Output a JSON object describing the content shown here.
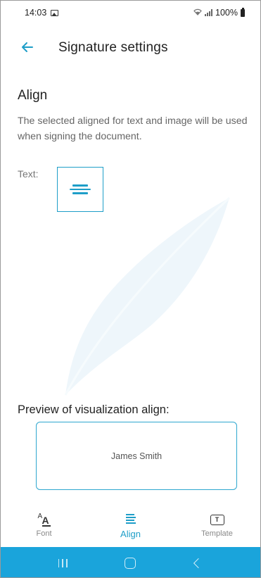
{
  "status_bar": {
    "time": "14:03",
    "battery": "100%",
    "icons": [
      "gallery-icon",
      "wifi-icon",
      "signal-icon",
      "battery-icon"
    ]
  },
  "app_bar": {
    "back_icon": "arrow-left-icon",
    "title": "Signature settings"
  },
  "align_section": {
    "title": "Align",
    "description": "The selected aligned for text and image will be used when signing the document.",
    "text_label": "Text:",
    "selected_alignment_icon": "align-center-icon"
  },
  "preview": {
    "label": "Preview of visualization align:",
    "name": "James Smith"
  },
  "bottom_nav": {
    "items": [
      {
        "label": "Font",
        "icon": "font-icon",
        "active": false
      },
      {
        "label": "Align",
        "icon": "align-icon",
        "active": true
      },
      {
        "label": "Template",
        "icon": "template-icon",
        "active": false
      }
    ]
  },
  "system_nav": {
    "buttons": [
      "recents-icon",
      "home-icon",
      "back-icon"
    ]
  },
  "colors": {
    "accent": "#1e9ec8",
    "system_nav": "#1aa4db",
    "text_primary": "#222222",
    "text_secondary": "#666666"
  }
}
